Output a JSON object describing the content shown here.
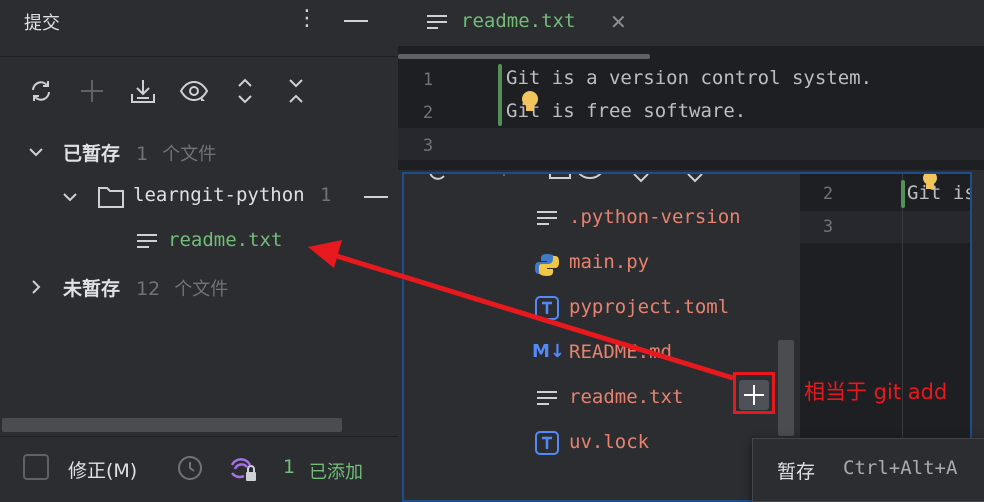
{
  "commit_panel": {
    "title": "提交",
    "toolbar": [
      "refresh-icon",
      "plus-icon",
      "download-icon",
      "eye-icon",
      "expand-icon",
      "collapse-icon"
    ],
    "staged": {
      "label": "已暂存",
      "count": "1",
      "unit": "个文件"
    },
    "folder": {
      "name": "learngit-python",
      "count": "1"
    },
    "staged_file": "readme.txt",
    "unstaged": {
      "label": "未暂存",
      "count": "12",
      "unit": "个文件"
    },
    "footer": {
      "amend_label": "修正(M)",
      "added_count": "1",
      "added_label": "已添加"
    }
  },
  "editor": {
    "tab_label": "readme.txt",
    "lines": [
      {
        "num": "1",
        "text": "Git is a version control system."
      },
      {
        "num": "2",
        "text": "Git is free software."
      },
      {
        "num": "3",
        "text": ""
      }
    ]
  },
  "overlay": {
    "files": [
      ".python-version",
      "main.py",
      "pyproject.toml",
      "README.md",
      "readme.txt",
      "uv.lock"
    ],
    "editor_lines": [
      {
        "num": "2",
        "text": "Git is"
      },
      {
        "num": "3",
        "text": ""
      }
    ],
    "tooltip": {
      "label": "暂存",
      "shortcut": "Ctrl+Alt+A"
    }
  },
  "annotation": "相当于 git add",
  "colors": {
    "accent_red": "#e8191e",
    "green_text": "#73bd79",
    "orange_text": "#e8826f",
    "editor_bg": "#1e1f22",
    "panel_bg": "#2b2d30"
  }
}
